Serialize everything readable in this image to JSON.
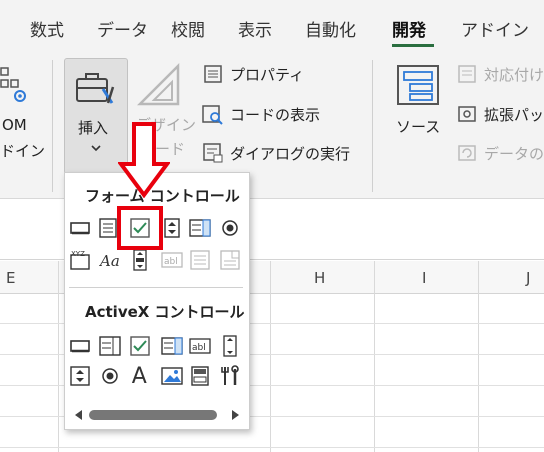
{
  "tabs": [
    {
      "label": "数式"
    },
    {
      "label": "データ"
    },
    {
      "label": "校閲"
    },
    {
      "label": "表示"
    },
    {
      "label": "自動化"
    },
    {
      "label": "開発"
    },
    {
      "label": "アドイン"
    }
  ],
  "ribbon": {
    "com_addins_line1": "OM",
    "com_addins_line2": "ドイン",
    "insert_label": "挿入",
    "design_mode_line1": "デザイン",
    "design_mode_line2": "モード",
    "properties": "プロパティ",
    "view_code": "コードの表示",
    "run_dialog": "ダイアログの実行",
    "source": "ソース",
    "map_properties": "対応付け",
    "expansion_packs": "拡張パッ",
    "refresh_data": "データの"
  },
  "columns": [
    "E",
    "H",
    "I",
    "J"
  ],
  "popup": {
    "form_controls_title": "フォーム コントロール",
    "activex_controls_title": "ActiveX コントロール",
    "form_controls": [
      "button",
      "combo-box",
      "check-box",
      "spin-button",
      "list-box",
      "option-button",
      "group-box",
      "label",
      "scroll-bar",
      "text-field",
      "combo-list-edit",
      "combo-dropdown-edit"
    ],
    "activex_controls": [
      "command-button",
      "combo-box",
      "check-box",
      "list-box",
      "text-box",
      "scroll-bar",
      "spin-button",
      "option-button",
      "label",
      "image",
      "toggle-button",
      "more-controls"
    ]
  },
  "colors": {
    "accent": "#2a6e3f",
    "highlight": "#e8000d",
    "check": "#2e8b57"
  }
}
